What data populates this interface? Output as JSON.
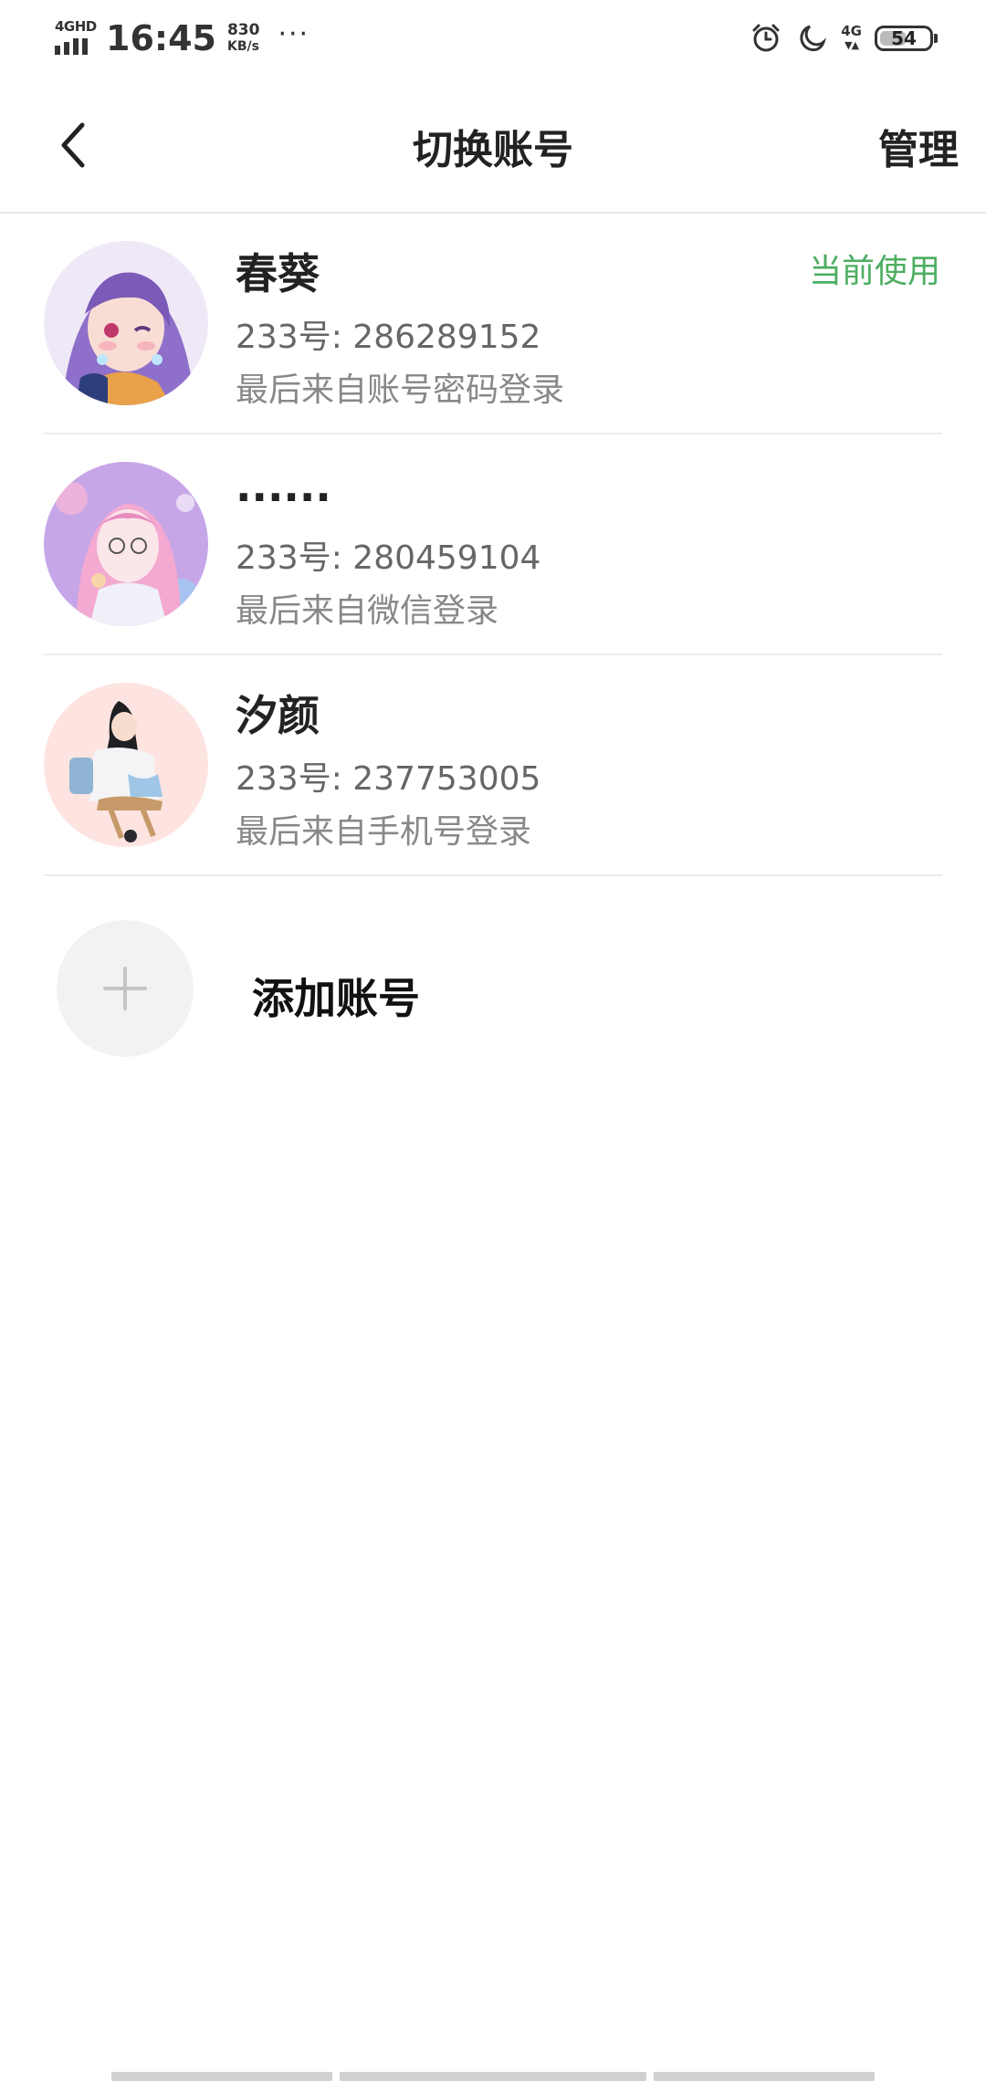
{
  "status_bar": {
    "network": "4GHD",
    "time": "16:45",
    "speed_value": "830",
    "speed_unit": "KB/s",
    "more_dots": "···",
    "net_type": "4G",
    "battery": "54",
    "battery_level": 0.54
  },
  "header": {
    "title": "切换账号",
    "manage_label": "管理"
  },
  "accounts": [
    {
      "name": "春葵",
      "id_line": "233号: 286289152",
      "login_line": "最后来自账号密码登录",
      "badge": "当前使用"
    },
    {
      "name": "......",
      "id_line": "233号: 280459104",
      "login_line": "最后来自微信登录"
    },
    {
      "name": "汐颜",
      "id_line": "233号: 237753005",
      "login_line": "最后来自手机号登录"
    }
  ],
  "add_account": {
    "label": "添加账号"
  },
  "colors": {
    "accent_green": "#4cae60",
    "divider": "#ececec",
    "add_circle_bg": "#f2f2f2"
  },
  "icons": {
    "back": "chevron-left-icon",
    "add": "plus-icon",
    "alarm": "alarm-clock-icon",
    "dnd": "moon-icon"
  }
}
